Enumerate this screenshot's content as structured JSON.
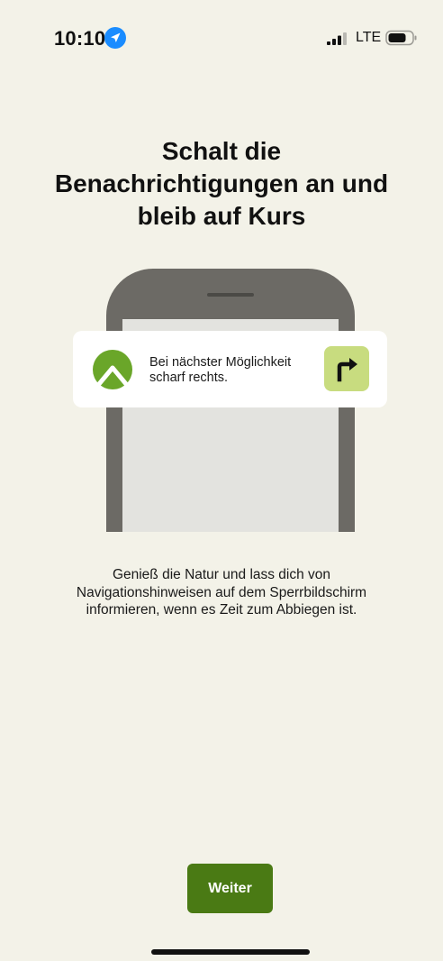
{
  "status_bar": {
    "time": "10:10",
    "network": "LTE",
    "location_icon": "location-arrow-icon",
    "signal_icon": "cellular-signal-icon",
    "battery_icon": "battery-icon",
    "accent_color": "#1a8cff"
  },
  "title": {
    "line1": "Schalt die",
    "line2": "Benachrichtigungen an und",
    "line3": "bleib auf Kurs"
  },
  "notification": {
    "line1": "Bei nächster Möglichkeit",
    "line2": "scharf rechts.",
    "app_icon": "komoot-logo-icon",
    "action_icon": "turn-right-arrow-icon",
    "logo_color": "#6aa629",
    "turn_badge_color": "#c8dc7f"
  },
  "description": {
    "line1": "Genieß die Natur und lass dich von",
    "line2": "Navigationshinweisen auf dem Sperrbildschirm",
    "line3": "informieren, wenn es Zeit zum Abbiegen ist."
  },
  "button": {
    "label": "Weiter",
    "color": "#4a7a14"
  },
  "colors": {
    "background": "#f3f2e8",
    "phone_frame": "#6c6a65",
    "phone_screen": "#e3e3df"
  }
}
